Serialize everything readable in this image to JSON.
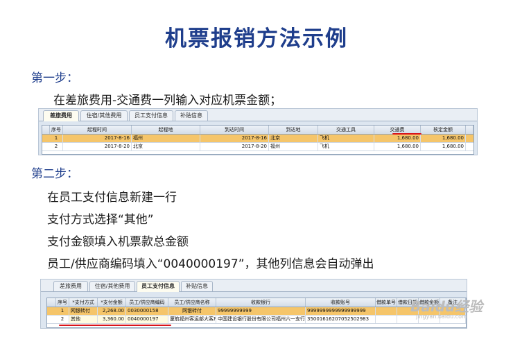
{
  "title": "机票报销方法示例",
  "step1": {
    "heading": "第一步：",
    "text": "在差旅费用-交通费一列输入对应机票金额；"
  },
  "table1": {
    "tabs": [
      "差旅费用",
      "住宿/其他费用",
      "员工支付信息",
      "补贴信息"
    ],
    "active_tab": 0,
    "columns": [
      "序号",
      "起程时间",
      "起程地",
      "到达时间",
      "到达地",
      "交通工具",
      "交通费",
      "核定金额"
    ],
    "rows": [
      [
        "1",
        "2017-8-16",
        "福州",
        "2017-8-16",
        "北京",
        "飞机",
        "1,680.00",
        "1,680.00"
      ],
      [
        "2",
        "2017-8-20",
        "北京",
        "2017-8-20",
        "福州",
        "飞机",
        "1,680.00",
        "1,680.00"
      ]
    ]
  },
  "step2": {
    "heading": "第二步：",
    "lines": [
      "在员工支付信息新建一行",
      "支付方式选择“其他”",
      "支付金额填入机票款总金额",
      "员工/供应商编码填入“0040000197”，其他列信息会自动弹出"
    ]
  },
  "table2": {
    "tabs": [
      "差旅费用",
      "住宿/其他费用",
      "员工支付信息",
      "补贴信息"
    ],
    "active_tab": 2,
    "columns": [
      "序号",
      "*支付方式",
      "*支付金额",
      "员工/供应商编码",
      "员工/供应商名称",
      "收款银行",
      "收款账号",
      "借款单号",
      "借款日期",
      "借款金额",
      "备注"
    ],
    "rows": [
      [
        "1",
        "网银转付",
        "2,268.00",
        "0030000158",
        "网银转付",
        "99999999999",
        "9999999999999999999",
        "",
        "",
        "",
        ""
      ],
      [
        "2",
        "其他",
        "3,360.00",
        "0040000197",
        "厦航福州客运部大客户",
        "中国建设银行股份有限公司福州六一支行",
        "35001616207052502983",
        "",
        "",
        "",
        ""
      ]
    ]
  },
  "watermark": {
    "brand": "Baidu经验",
    "sub": "jingyan.baidu.com"
  },
  "colors": {
    "title": "#1f3e8c",
    "selected_row": "#f5c56a",
    "underline": "#d9141b"
  }
}
